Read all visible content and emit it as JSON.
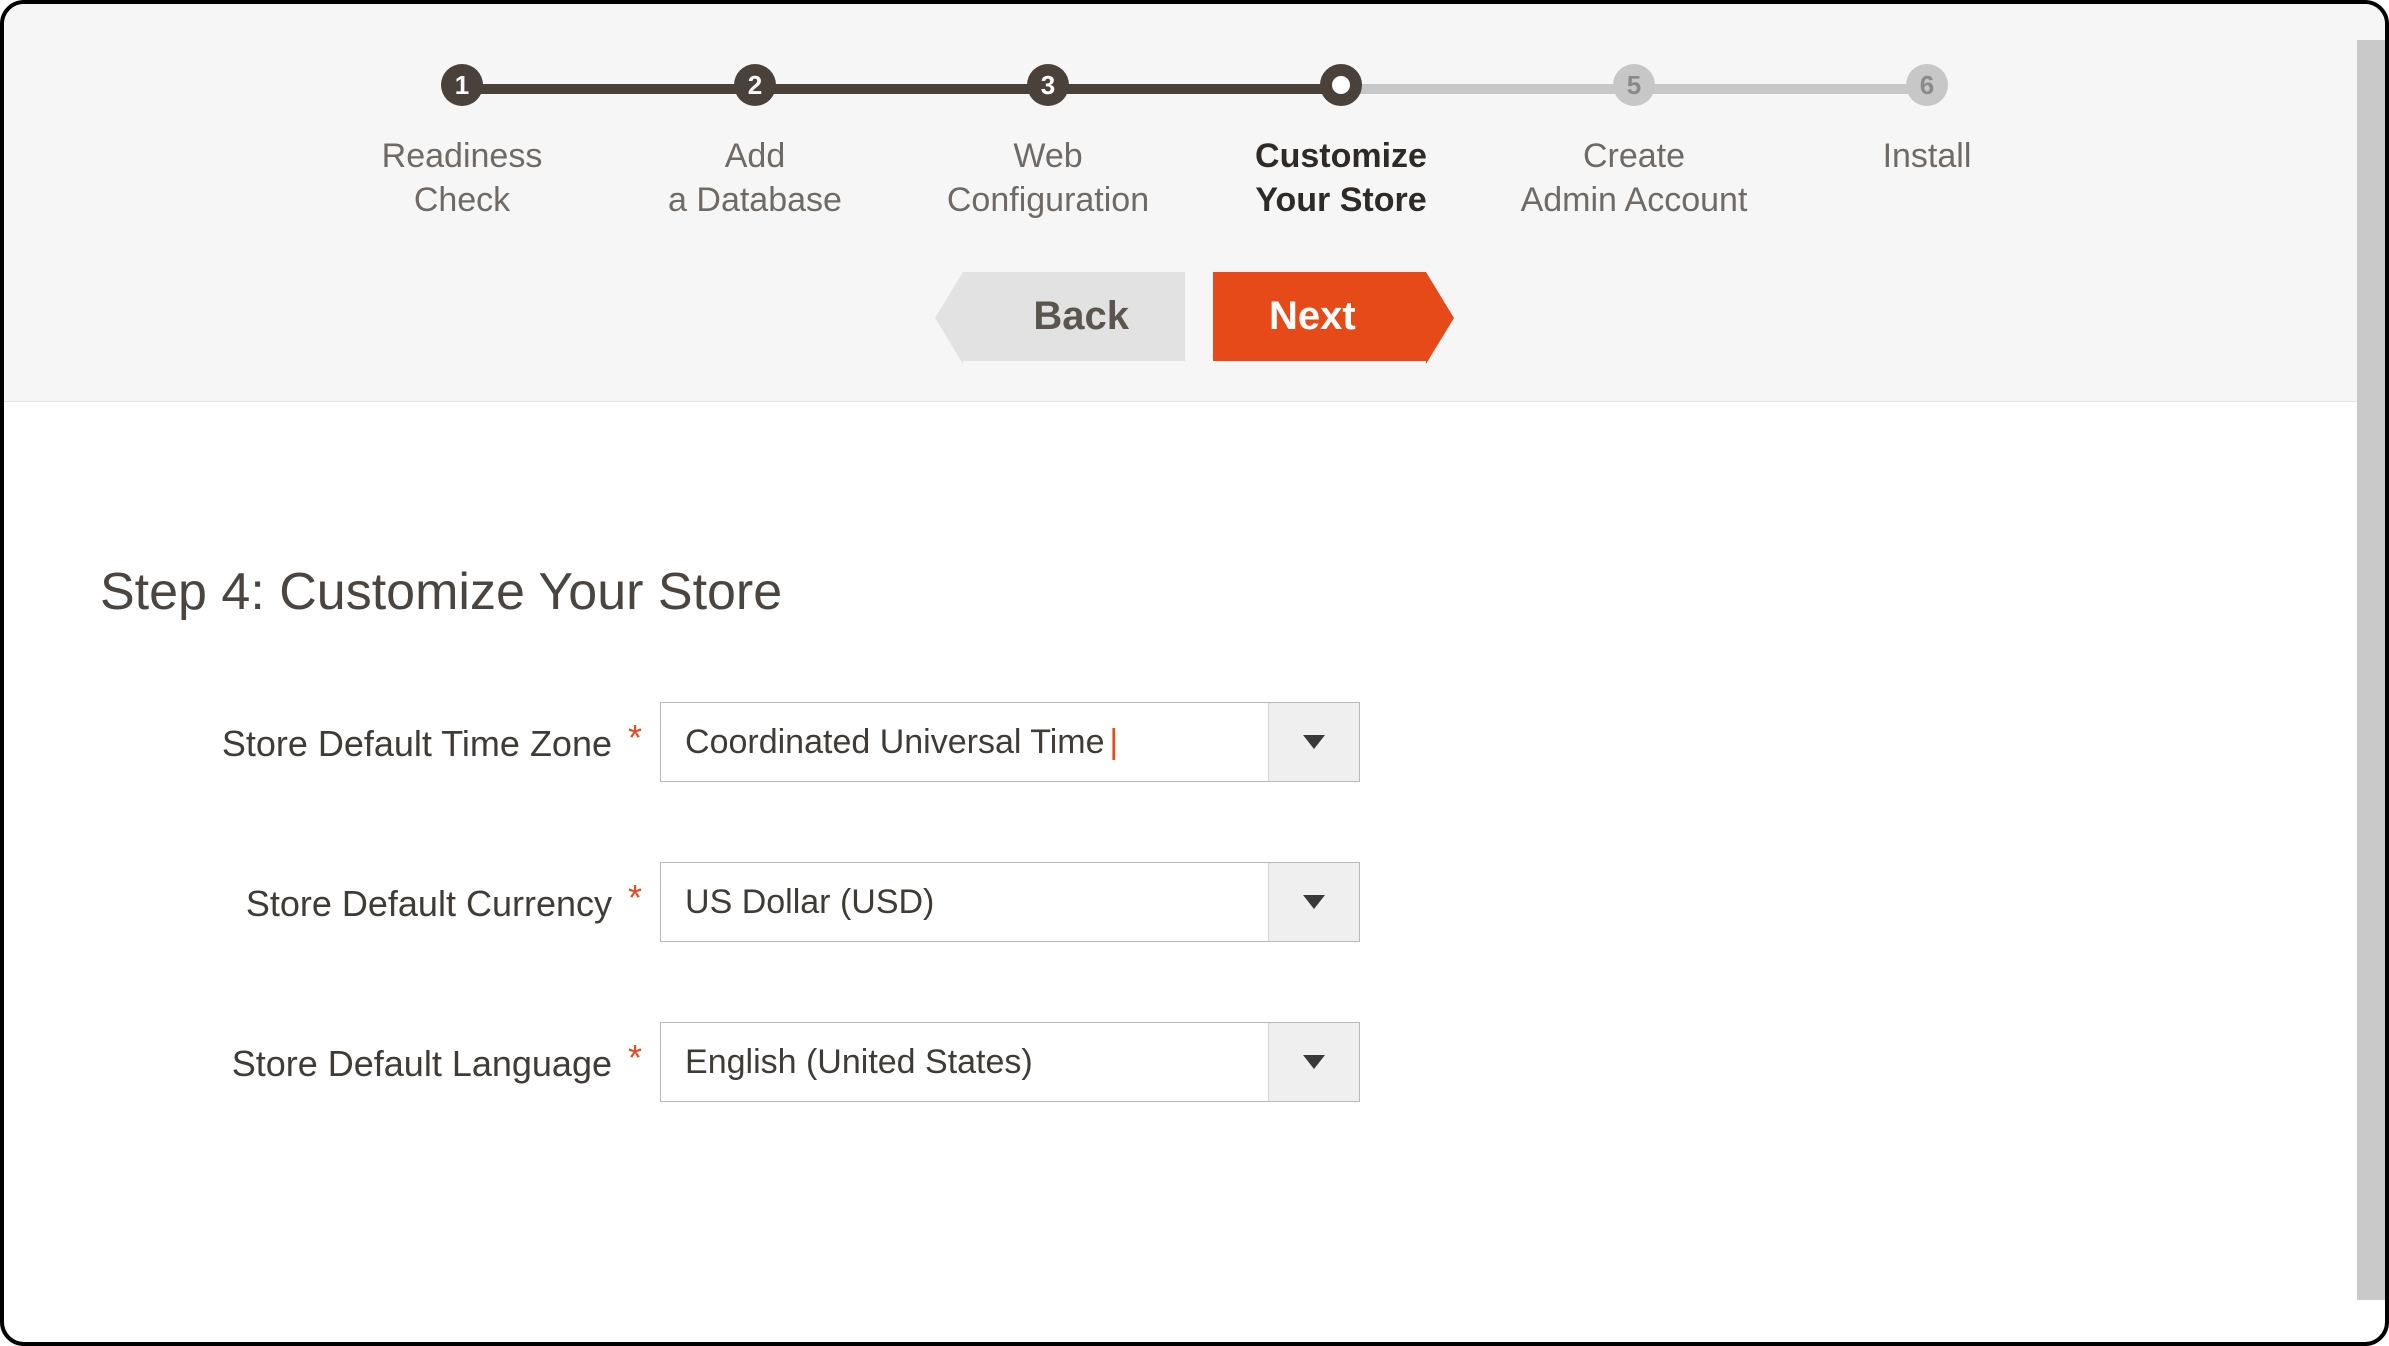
{
  "wizard": {
    "steps": [
      {
        "num": "1",
        "label": "Readiness\nCheck",
        "state": "done"
      },
      {
        "num": "2",
        "label": "Add\na Database",
        "state": "done"
      },
      {
        "num": "3",
        "label": "Web\nConfiguration",
        "state": "done"
      },
      {
        "num": "",
        "label": "Customize\nYour Store",
        "state": "current"
      },
      {
        "num": "5",
        "label": "Create\nAdmin Account",
        "state": "future"
      },
      {
        "num": "6",
        "label": "Install",
        "state": "future"
      }
    ],
    "back_label": "Back",
    "next_label": "Next"
  },
  "page": {
    "title": "Step 4: Customize Your Store"
  },
  "form": {
    "timezone": {
      "label": "Store Default Time Zone",
      "value": "Coordinated Universal Time",
      "required_marker": "*"
    },
    "currency": {
      "label": "Store Default Currency",
      "value": "US Dollar (USD)",
      "required_marker": "*"
    },
    "language": {
      "label": "Store Default Language",
      "value": "English (United States)",
      "required_marker": "*"
    }
  }
}
